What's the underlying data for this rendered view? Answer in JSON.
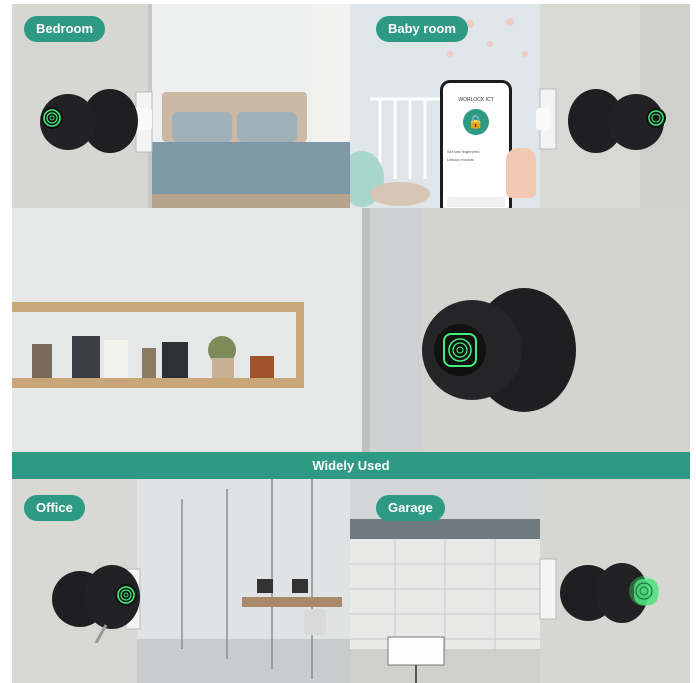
{
  "labels": {
    "bedroom": "Bedroom",
    "baby_room": "Baby room",
    "widely_used": "Widely Used",
    "office": "Office",
    "garage": "Garage"
  },
  "phone": {
    "app_name": "WORLOCK ICT",
    "list_item_1": "Set fast fingerprint",
    "list_item_2": "Unlock records"
  },
  "colors": {
    "accent": "#2f9a84",
    "fingerprint_glow": "#3ff07a",
    "knob": "#1c1c1e",
    "door": "#d9d9d6"
  },
  "icons": [
    "fingerprint-icon",
    "lock-icon",
    "phone-icon"
  ]
}
